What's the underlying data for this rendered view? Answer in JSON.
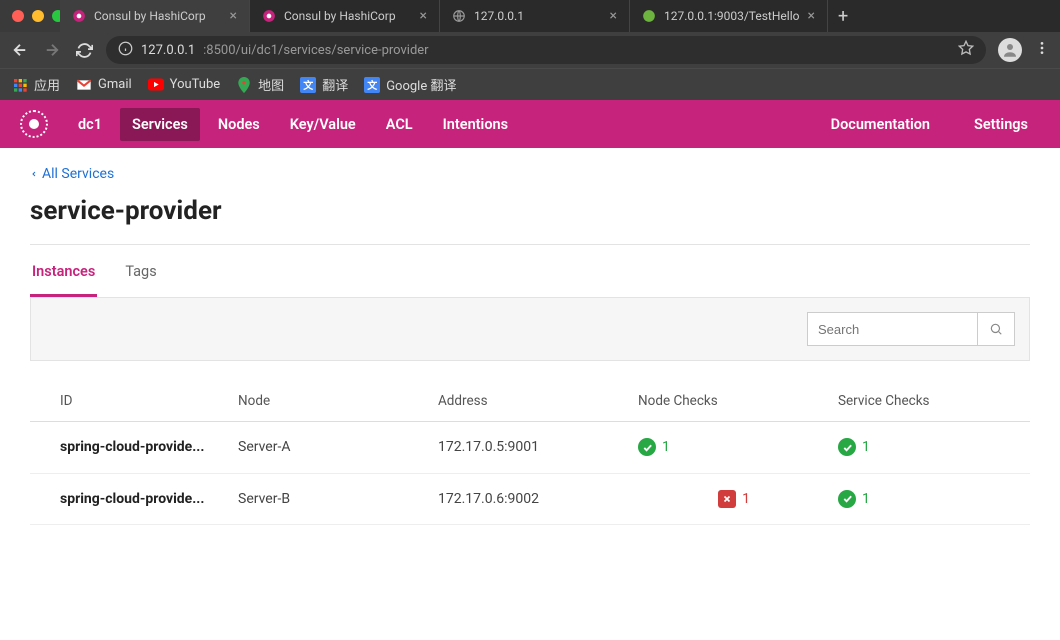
{
  "browser": {
    "tabs": [
      {
        "title": "Consul by HashiCorp",
        "active": true,
        "icon": "consul"
      },
      {
        "title": "Consul by HashiCorp",
        "active": false,
        "icon": "consul"
      },
      {
        "title": "127.0.0.1",
        "active": false,
        "icon": "globe"
      },
      {
        "title": "127.0.0.1:9003/TestHello",
        "active": false,
        "icon": "spring"
      }
    ],
    "url_host": "127.0.0.1",
    "url_port_path": ":8500/ui/dc1/services/service-provider",
    "bookmarks": [
      {
        "label": "应用",
        "icon": "apps",
        "color": ""
      },
      {
        "label": "Gmail",
        "icon": "gmail",
        "color": "#EA4335"
      },
      {
        "label": "YouTube",
        "icon": "youtube",
        "color": "#FF0000"
      },
      {
        "label": "地图",
        "icon": "maps",
        "color": "#34A853"
      },
      {
        "label": "翻译",
        "icon": "trans",
        "color": "#4285F4"
      },
      {
        "label": "Google 翻译",
        "icon": "trans",
        "color": "#4285F4"
      }
    ]
  },
  "consul_nav": {
    "dc": "dc1",
    "items": [
      "Services",
      "Nodes",
      "Key/Value",
      "ACL",
      "Intentions"
    ],
    "active": "Services",
    "right": [
      "Documentation",
      "Settings"
    ]
  },
  "page": {
    "back_link": "All Services",
    "title": "service-provider",
    "tabs": [
      "Instances",
      "Tags"
    ],
    "active_tab": "Instances",
    "search_placeholder": "Search"
  },
  "table": {
    "headers": [
      "ID",
      "Node",
      "Address",
      "Node Checks",
      "Service Checks"
    ],
    "rows": [
      {
        "id": "spring-cloud-provide...",
        "node": "Server-A",
        "address": "172.17.0.5:9001",
        "node_checks": {
          "status": "ok",
          "count": "1"
        },
        "service_checks": {
          "status": "ok",
          "count": "1"
        }
      },
      {
        "id": "spring-cloud-provide...",
        "node": "Server-B",
        "address": "172.17.0.6:9002",
        "node_checks": {
          "status": "fail",
          "count": "1"
        },
        "service_checks": {
          "status": "ok",
          "count": "1"
        }
      }
    ]
  }
}
